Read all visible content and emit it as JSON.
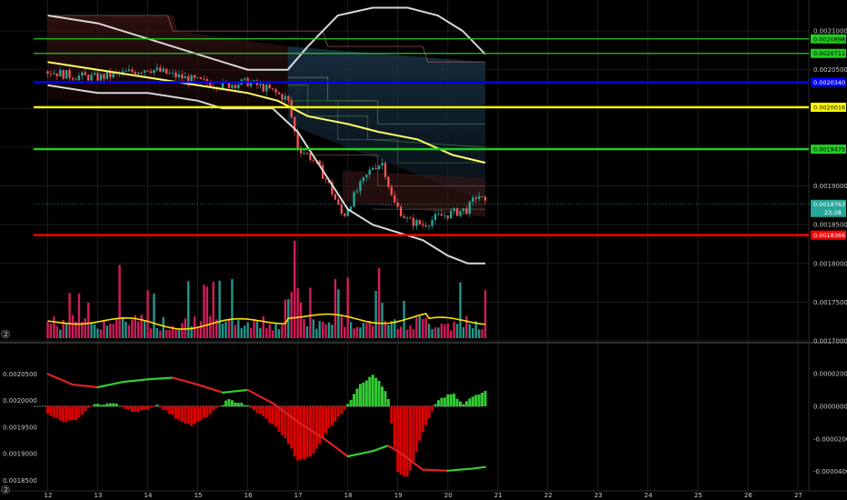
{
  "chart_data": [
    {
      "type": "candlestick",
      "panel": "price",
      "x_ticks": [
        "12",
        "13",
        "14",
        "15",
        "16",
        "17",
        "18",
        "19",
        "20",
        "21",
        "22",
        "23",
        "24",
        "25",
        "26",
        "27"
      ],
      "y_ticks": [
        "0.0021000",
        "0.0020500",
        "0.0019000",
        "0.0018500",
        "0.0018000",
        "0.0017500",
        "0.0017000"
      ],
      "ylim": [
        0.0017,
        0.00214
      ],
      "price_series": [
        {
          "day": 12.0,
          "value": 0.002048
        },
        {
          "day": 12.5,
          "value": 0.002042
        },
        {
          "day": 13.0,
          "value": 0.00204
        },
        {
          "day": 13.5,
          "value": 0.002045
        },
        {
          "day": 14.0,
          "value": 0.002052
        },
        {
          "day": 14.5,
          "value": 0.002043
        },
        {
          "day": 15.0,
          "value": 0.002035
        },
        {
          "day": 15.5,
          "value": 0.00203
        },
        {
          "day": 16.0,
          "value": 0.002034
        },
        {
          "day": 16.4,
          "value": 0.002025
        },
        {
          "day": 16.8,
          "value": 0.002012
        },
        {
          "day": 17.0,
          "value": 0.00195
        },
        {
          "day": 17.3,
          "value": 0.001935
        },
        {
          "day": 17.6,
          "value": 0.001905
        },
        {
          "day": 17.9,
          "value": 0.00186
        },
        {
          "day": 18.2,
          "value": 0.001895
        },
        {
          "day": 18.5,
          "value": 0.001925
        },
        {
          "day": 18.7,
          "value": 0.00193
        },
        {
          "day": 18.9,
          "value": 0.00188
        },
        {
          "day": 19.2,
          "value": 0.001855
        },
        {
          "day": 19.5,
          "value": 0.00185
        },
        {
          "day": 19.8,
          "value": 0.00186
        },
        {
          "day": 20.1,
          "value": 0.001865
        },
        {
          "day": 20.4,
          "value": 0.00187
        },
        {
          "day": 20.6,
          "value": 0.00189
        },
        {
          "day": 20.75,
          "value": 0.001876
        }
      ],
      "horizontal_levels": [
        {
          "value": 0.0020898,
          "label": "0.0020898",
          "color": "#22cc22"
        },
        {
          "value": 0.0020711,
          "label": "0.0020711",
          "color": "#22cc22"
        },
        {
          "value": 0.002034,
          "label": "0.0020340",
          "color": "#0000ff"
        },
        {
          "value": 0.0020016,
          "label": "0.0020016",
          "color": "#ffff00"
        },
        {
          "value": 0.0019475,
          "label": "0.0019475",
          "color": "#22cc22"
        },
        {
          "value": 0.0018366,
          "label": "0.0018366",
          "color": "#ff0000"
        }
      ],
      "current_price": {
        "value": 0.0018763,
        "label": "0.0018763",
        "countdown": "23:28",
        "color": "#26a69a"
      }
    },
    {
      "type": "histogram",
      "panel": "oscillator",
      "x_ticks": [
        "12",
        "13",
        "14",
        "15",
        "16",
        "17",
        "18",
        "19",
        "20",
        "21",
        "22",
        "23",
        "24",
        "25",
        "26",
        "27"
      ],
      "y_ticks_left": [
        "0.0020500",
        "0.0020000",
        "0.0019500",
        "0.0019000",
        "0.0018500"
      ],
      "y_ticks_right": [
        "0.0000200",
        "0.0000000",
        "-0.0000200",
        "-0.0000400"
      ],
      "ylim": [
        -5.2e-05,
        3.3e-05
      ],
      "histogram": [
        {
          "day": 12.0,
          "value": -4e-06
        },
        {
          "day": 12.3,
          "value": -1e-05
        },
        {
          "day": 12.6,
          "value": -8e-06
        },
        {
          "day": 12.9,
          "value": 1e-06
        },
        {
          "day": 13.3,
          "value": 2e-06
        },
        {
          "day": 13.8,
          "value": -4e-06
        },
        {
          "day": 14.2,
          "value": 1e-06
        },
        {
          "day": 14.6,
          "value": -8e-06
        },
        {
          "day": 14.9,
          "value": -1.2e-05
        },
        {
          "day": 15.2,
          "value": -6e-06
        },
        {
          "day": 15.6,
          "value": 4e-06
        },
        {
          "day": 15.9,
          "value": 2e-06
        },
        {
          "day": 16.3,
          "value": -6e-06
        },
        {
          "day": 16.6,
          "value": -1.4e-05
        },
        {
          "day": 16.8,
          "value": -2.2e-05
        },
        {
          "day": 17.0,
          "value": -3.4e-05
        },
        {
          "day": 17.3,
          "value": -3e-05
        },
        {
          "day": 17.6,
          "value": -1.4e-05
        },
        {
          "day": 17.9,
          "value": -4e-06
        },
        {
          "day": 18.2,
          "value": 1.2e-05
        },
        {
          "day": 18.5,
          "value": 2e-05
        },
        {
          "day": 18.8,
          "value": 8e-06
        },
        {
          "day": 19.0,
          "value": -4e-05
        },
        {
          "day": 19.2,
          "value": -4.4e-05
        },
        {
          "day": 19.5,
          "value": -1.6e-05
        },
        {
          "day": 19.8,
          "value": 4e-06
        },
        {
          "day": 20.1,
          "value": 8e-06
        },
        {
          "day": 20.3,
          "value": 1e-06
        },
        {
          "day": 20.5,
          "value": 6e-06
        },
        {
          "day": 20.75,
          "value": 1e-05
        }
      ],
      "signal_line": [
        {
          "day": 12.0,
          "value": 0.00205
        },
        {
          "day": 12.5,
          "value": 0.00203
        },
        {
          "day": 13.0,
          "value": 0.002025
        },
        {
          "day": 13.5,
          "value": 0.002035
        },
        {
          "day": 14.0,
          "value": 0.00204
        },
        {
          "day": 14.5,
          "value": 0.002043
        },
        {
          "day": 15.0,
          "value": 0.00203
        },
        {
          "day": 15.5,
          "value": 0.002015
        },
        {
          "day": 16.0,
          "value": 0.00202
        },
        {
          "day": 16.5,
          "value": 0.001995
        },
        {
          "day": 17.0,
          "value": 0.00196
        },
        {
          "day": 17.5,
          "value": 0.00193
        },
        {
          "day": 18.0,
          "value": 0.001895
        },
        {
          "day": 18.5,
          "value": 0.001905
        },
        {
          "day": 18.8,
          "value": 0.001915
        },
        {
          "day": 19.0,
          "value": 0.001905
        },
        {
          "day": 19.5,
          "value": 0.00187
        },
        {
          "day": 20.0,
          "value": 0.001868
        },
        {
          "day": 20.5,
          "value": 0.001872
        },
        {
          "day": 20.75,
          "value": 0.001875
        }
      ],
      "signal_ylim": [
        0.00183,
        0.00209
      ]
    }
  ],
  "pane_markers": [
    "2",
    "2"
  ],
  "colors": {
    "up": "#26a69a",
    "down": "#ef5350",
    "hist_up": "#33cc33",
    "hist_down": "#dd0000",
    "band": "#d8d8d8",
    "ma": "#ffff66",
    "grid": "#1a1a1a"
  }
}
